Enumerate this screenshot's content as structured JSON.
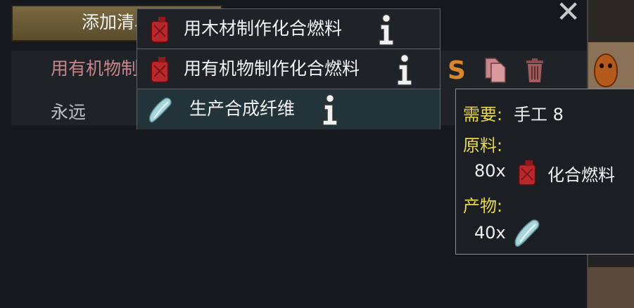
{
  "window": {
    "close_glyph": "✕",
    "add_bill_label": "添加清单"
  },
  "bill": {
    "title": "用有机物制作化合燃料",
    "repeat_mode": "永远",
    "suspend_glyph": "S"
  },
  "dropdown": {
    "options": [
      {
        "label": "用木材制作化合燃料",
        "icon": "chemfuel-canister-icon"
      },
      {
        "label": "用有机物制作化合燃料",
        "icon": "chemfuel-canister-icon"
      },
      {
        "label": "生产合成纤维",
        "icon": "synthetic-fiber-icon"
      }
    ]
  },
  "tooltip": {
    "work_label": "需要:",
    "work_value": "手工 8",
    "ingredients_label": "原料:",
    "ingredient_qty": "80x",
    "ingredient_name": "化合燃料",
    "products_label": "产物:",
    "product_qty": "40x"
  },
  "colors": {
    "accent_yellow": "#e8d650",
    "bill_title": "#c9868a",
    "suspend_orange": "#d8882a",
    "highlight_row": "#22343a"
  }
}
